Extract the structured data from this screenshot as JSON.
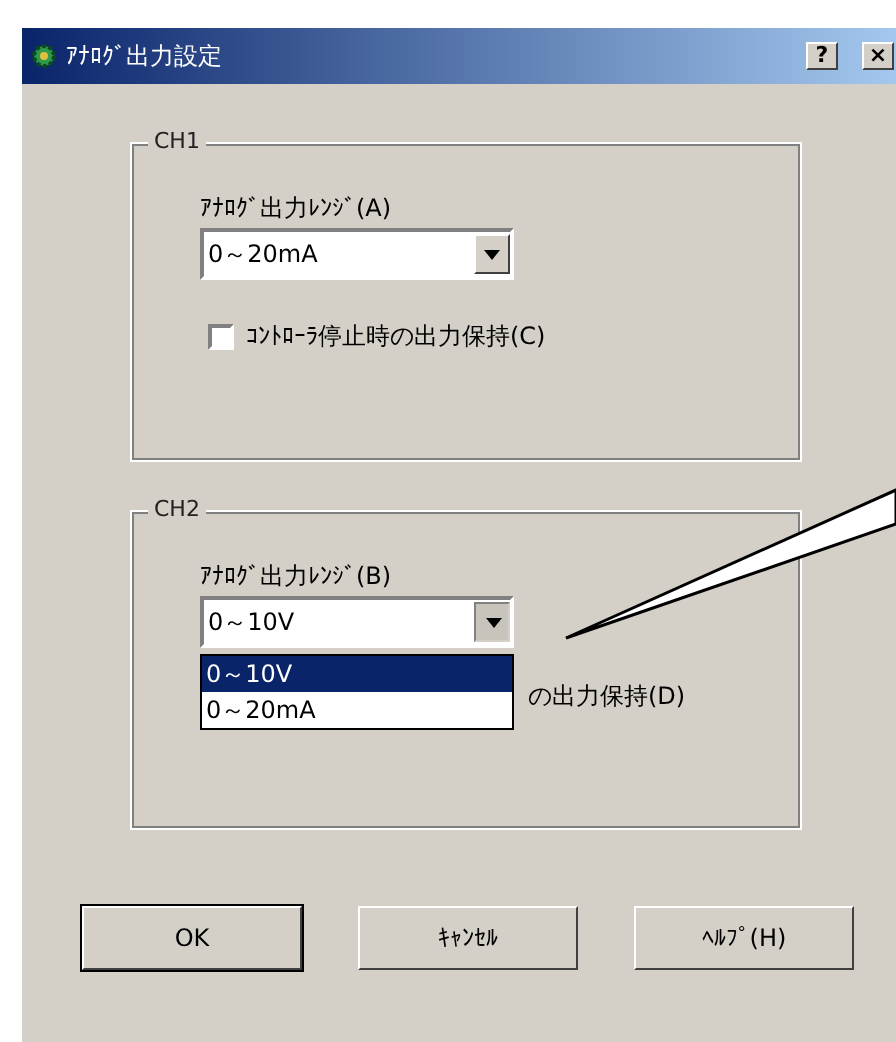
{
  "window": {
    "title": "ｱﾅﾛｸﾞ出力設定",
    "help_button": "?",
    "close_button": "×"
  },
  "groups": [
    {
      "title": "CH1",
      "range_label": "ｱﾅﾛｸﾞ出力ﾚﾝｼﾞ(A)",
      "value": "0～20mA",
      "hold": {
        "label": "ｺﾝﾄﾛｰﾗ停止時の出力保持(C)",
        "checked": false
      },
      "expanded": false
    },
    {
      "title": "CH2",
      "range_label": "ｱﾅﾛｸﾞ出力ﾚﾝｼﾞ(B)",
      "value": "0～10V",
      "hold": {
        "label": "の出力保持(D)"
      },
      "expanded": true,
      "options": [
        {
          "label": "0～10V",
          "selected": true
        },
        {
          "label": "0～20mA",
          "selected": false
        }
      ]
    }
  ],
  "buttons": [
    "OK",
    "ｷｬﾝｾﾙ",
    "ﾍﾙﾌﾟ(H)"
  ]
}
